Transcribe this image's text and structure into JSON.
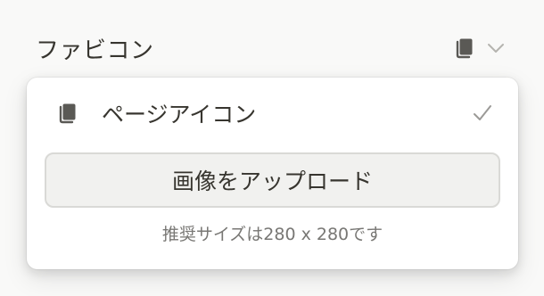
{
  "field": {
    "label": "ファビコン",
    "trigger_icon": "page-icon",
    "chevron_icon": "chevron-down-icon"
  },
  "dropdown": {
    "option": {
      "icon": "page-icon",
      "label": "ページアイコン",
      "selected": true,
      "check_icon": "check-icon"
    },
    "upload_button_label": "画像をアップロード",
    "hint": "推奨サイズは280 x 280です"
  },
  "colors": {
    "background": "#f9f9f8",
    "text": "#37352f",
    "muted_text": "#787774",
    "icon": "#5a5955",
    "button_background": "#f1f1ef",
    "button_border": "#d9d9d6"
  }
}
